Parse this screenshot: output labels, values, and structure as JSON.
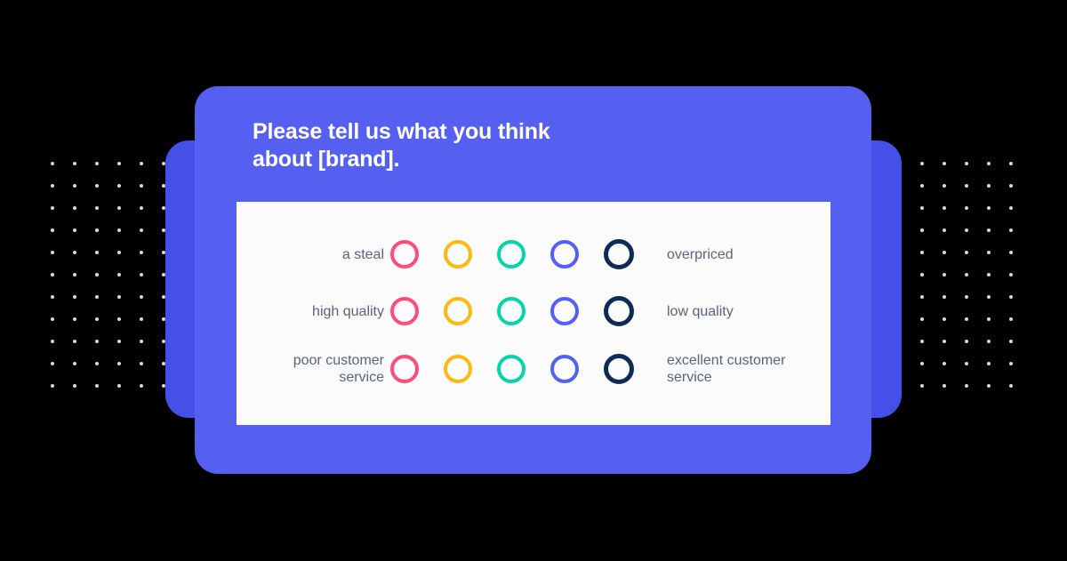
{
  "theme": {
    "background": "#000000",
    "card_color": "#5560f0",
    "back_panel_color": "#4550e8",
    "panel_color": "#fbfbfb",
    "title_color": "#ffffff",
    "label_color": "#5a6478",
    "dot_color": "#d8d8dd"
  },
  "card": {
    "title_line_1": "Please tell us what you think",
    "title_line_2": "about [brand]."
  },
  "matrix": {
    "scale_points": [
      {
        "name": "option-1",
        "color": "#ff4d79"
      },
      {
        "name": "option-2",
        "color": "#fdb913"
      },
      {
        "name": "option-3",
        "color": "#06d6a7"
      },
      {
        "name": "option-4",
        "color": "#5560f0"
      },
      {
        "name": "option-5",
        "color": "#0d2a58"
      }
    ],
    "rows": [
      {
        "id": "price",
        "left_label": "a steal",
        "left_label_lines": [
          "a steal"
        ],
        "right_label": "overpriced",
        "right_label_lines": [
          "overpriced"
        ]
      },
      {
        "id": "quality",
        "left_label": "high quality",
        "left_label_lines": [
          "high quality"
        ],
        "right_label": "low quality",
        "right_label_lines": [
          "low quality"
        ]
      },
      {
        "id": "customer-service",
        "left_label": "poor customer service",
        "left_label_lines": [
          "poor customer",
          "service"
        ],
        "right_label": "excellent customer service",
        "right_label_lines": [
          "excellent customer",
          "service"
        ]
      }
    ]
  },
  "decoration": {
    "dot_grid_columns": 6,
    "dot_grid_rows": 11
  }
}
